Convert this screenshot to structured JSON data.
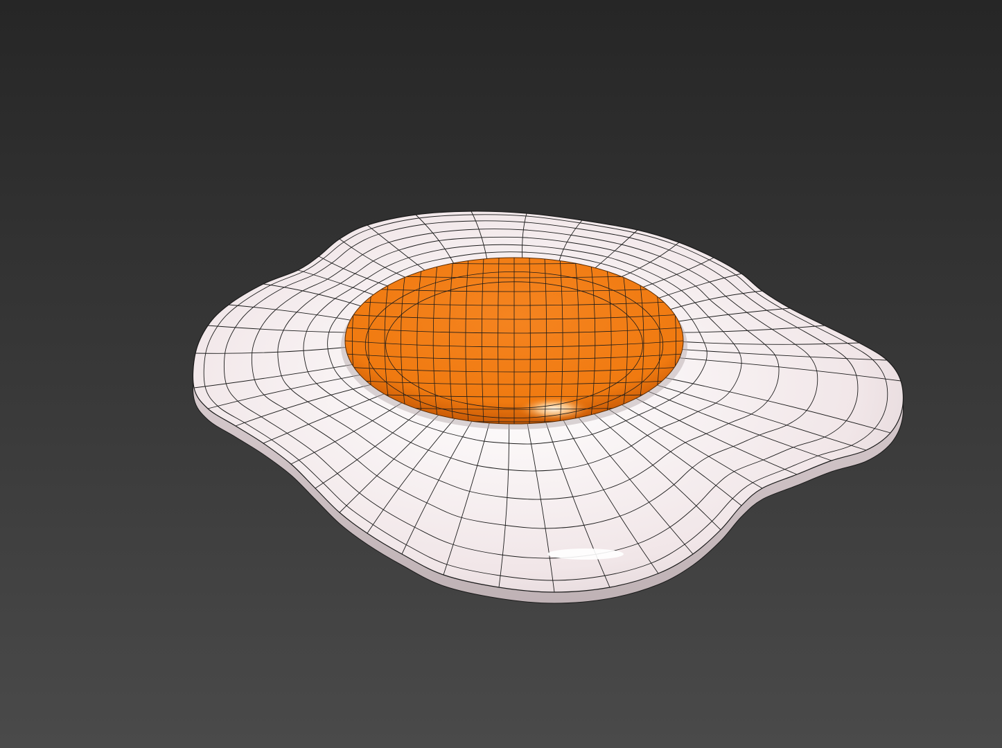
{
  "scene": {
    "subject": "fried-egg-wireframe-model",
    "colors": {
      "background_top": "#262626",
      "background_bottom": "#4a4a4a",
      "egg_white": "#f1e6e8",
      "egg_white_shadow": "#c9bcbf",
      "yolk": "#f07a10",
      "yolk_dark": "#c85a06",
      "yolk_highlight": "#fff2d6",
      "wire": "#1a1a1a"
    }
  }
}
